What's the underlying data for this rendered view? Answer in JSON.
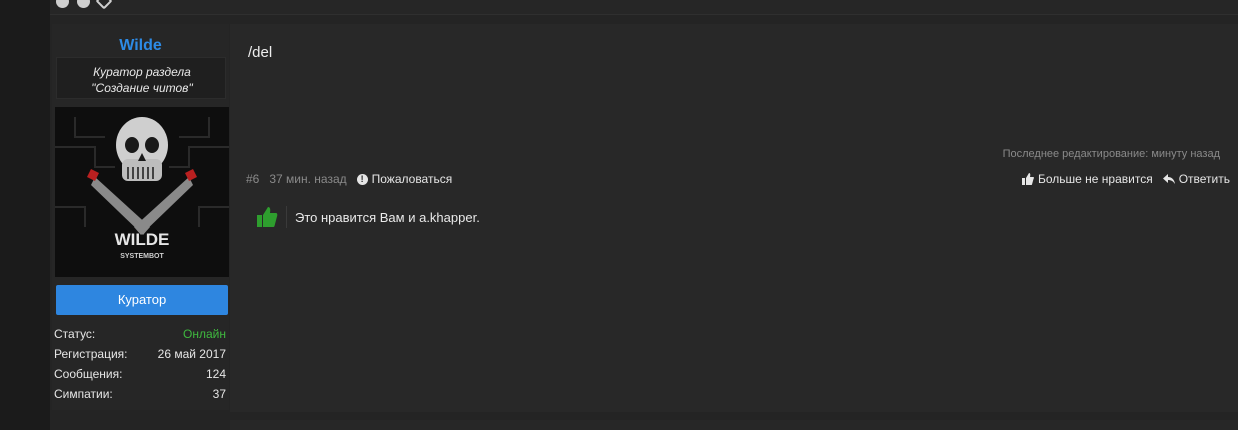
{
  "user": {
    "name": "Wilde",
    "title_line1": "Куратор раздела",
    "title_line2": "\"Создание читов\"",
    "avatar_caption": "WILDE",
    "avatar_subcaption": "SYSTEMBOT",
    "role_button": "Куратор",
    "stats": [
      {
        "label": "Статус:",
        "value": "Онлайн"
      },
      {
        "label": "Регистрация:",
        "value": "26 май 2017"
      },
      {
        "label": "Сообщения:",
        "value": "124"
      },
      {
        "label": "Симпатии:",
        "value": "37"
      }
    ]
  },
  "post": {
    "message": "/del",
    "last_edit": "Последнее редактирование: минуту назад",
    "number": "#6",
    "time": "37 мин. назад",
    "report": "Пожаловаться",
    "unlike": "Больше не нравится",
    "reply": "Ответить",
    "likes_text": "Это нравится Вам и a.khapper."
  },
  "colors": {
    "accent": "#2e86e0",
    "username": "#2d8be6",
    "online": "#3fb93f",
    "like_green": "#2e9e2e"
  }
}
